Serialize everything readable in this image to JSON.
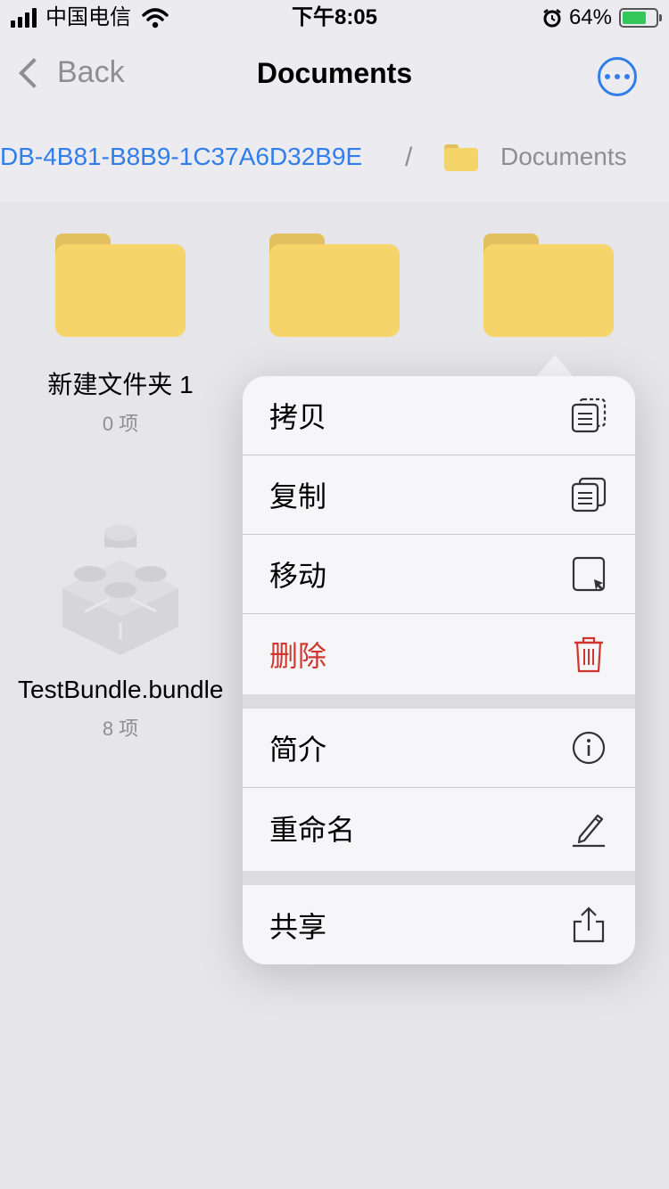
{
  "status_bar": {
    "carrier": "中国电信",
    "time": "下午8:05",
    "battery": "64%",
    "battery_level": 0.64
  },
  "nav": {
    "back_label": "Back",
    "title": "Documents"
  },
  "path": {
    "parent": "DB-4B81-B8B9-1C37A6D32B9E",
    "separator": "/",
    "current": "Documents"
  },
  "items": [
    {
      "name": "新建文件夹 1",
      "sub": "0 项"
    },
    {
      "name": "TestBundle.bundle",
      "sub": "8 项"
    }
  ],
  "menu": {
    "copy_label": "拷贝",
    "duplicate_label": "复制",
    "move_label": "移动",
    "delete_label": "删除",
    "info_label": "简介",
    "rename_label": "重命名",
    "share_label": "共享"
  },
  "colors": {
    "accent": "#2f7ee9",
    "danger": "#d0362e",
    "folder": "#f5d46a"
  }
}
